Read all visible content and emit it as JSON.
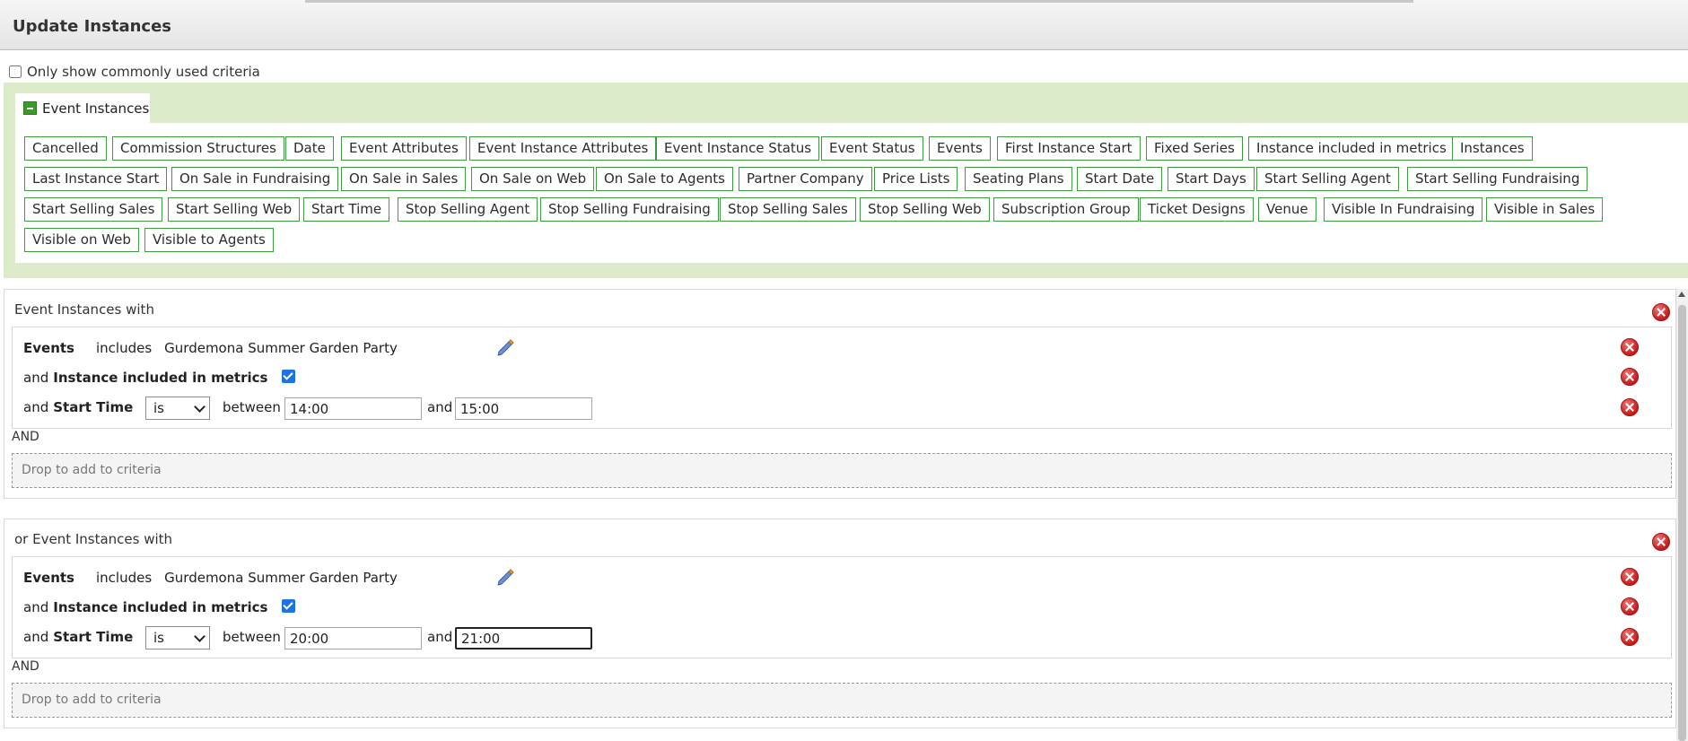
{
  "dialog": {
    "title": "Update Instances"
  },
  "common_toggle": {
    "label": "Only show commonly used criteria",
    "checked": false
  },
  "criteria_tab": {
    "label": "Event Instances"
  },
  "criteria_chips": [
    "Cancelled",
    "Commission Structures",
    "Date",
    "Event Attributes",
    "Event Instance Attributes",
    "Event Instance Status",
    "Event Status",
    "Events",
    "First Instance Start",
    "Fixed Series",
    "Instance included in metrics",
    "Instances",
    "Last Instance Start",
    "On Sale in Fundraising",
    "On Sale in Sales",
    "On Sale on Web",
    "On Sale to Agents",
    "Partner Company",
    "Price Lists",
    "Seating Plans",
    "Start Date",
    "Start Days",
    "Start Selling Agent",
    "Start Selling Fundraising",
    "Start Selling Sales",
    "Start Selling Web",
    "Start Time",
    "Stop Selling Agent",
    "Stop Selling Fundraising",
    "Stop Selling Sales",
    "Stop Selling Web",
    "Subscription Group",
    "Ticket Designs",
    "Venue",
    "Visible In Fundraising",
    "Visible in Sales",
    "Visible on Web",
    "Visible to Agents"
  ],
  "groups": [
    {
      "title": "Event Instances with",
      "rows": {
        "events": {
          "field": "Events",
          "operator": "includes",
          "value": "Gurdemona Summer Garden Party"
        },
        "metrics": {
          "prefix": "and",
          "field": "Instance included in metrics",
          "checked": true
        },
        "start_time": {
          "prefix": "and",
          "field": "Start Time",
          "operator": "is",
          "between": "between",
          "from": "14:00",
          "and": "and",
          "to": "15:00"
        }
      },
      "and_label": "AND",
      "drop_text": "Drop to add to criteria"
    },
    {
      "title": "or Event Instances with",
      "rows": {
        "events": {
          "field": "Events",
          "operator": "includes",
          "value": "Gurdemona Summer Garden Party"
        },
        "metrics": {
          "prefix": "and",
          "field": "Instance included in metrics",
          "checked": true
        },
        "start_time": {
          "prefix": "and",
          "field": "Start Time",
          "operator": "is",
          "between": "between",
          "from": "20:00",
          "and": "and",
          "to": "21:00"
        }
      },
      "and_label": "AND",
      "drop_text": "Drop to add to criteria"
    }
  ],
  "colors": {
    "chip_border": "#3e9a3e",
    "band": "#dcebc9",
    "remove": "#c51b1b",
    "checkbox": "#1a73e8"
  },
  "icons": {
    "remove": "remove-circle-icon",
    "edit": "pencil-icon",
    "collapse": "minus-box-icon"
  }
}
